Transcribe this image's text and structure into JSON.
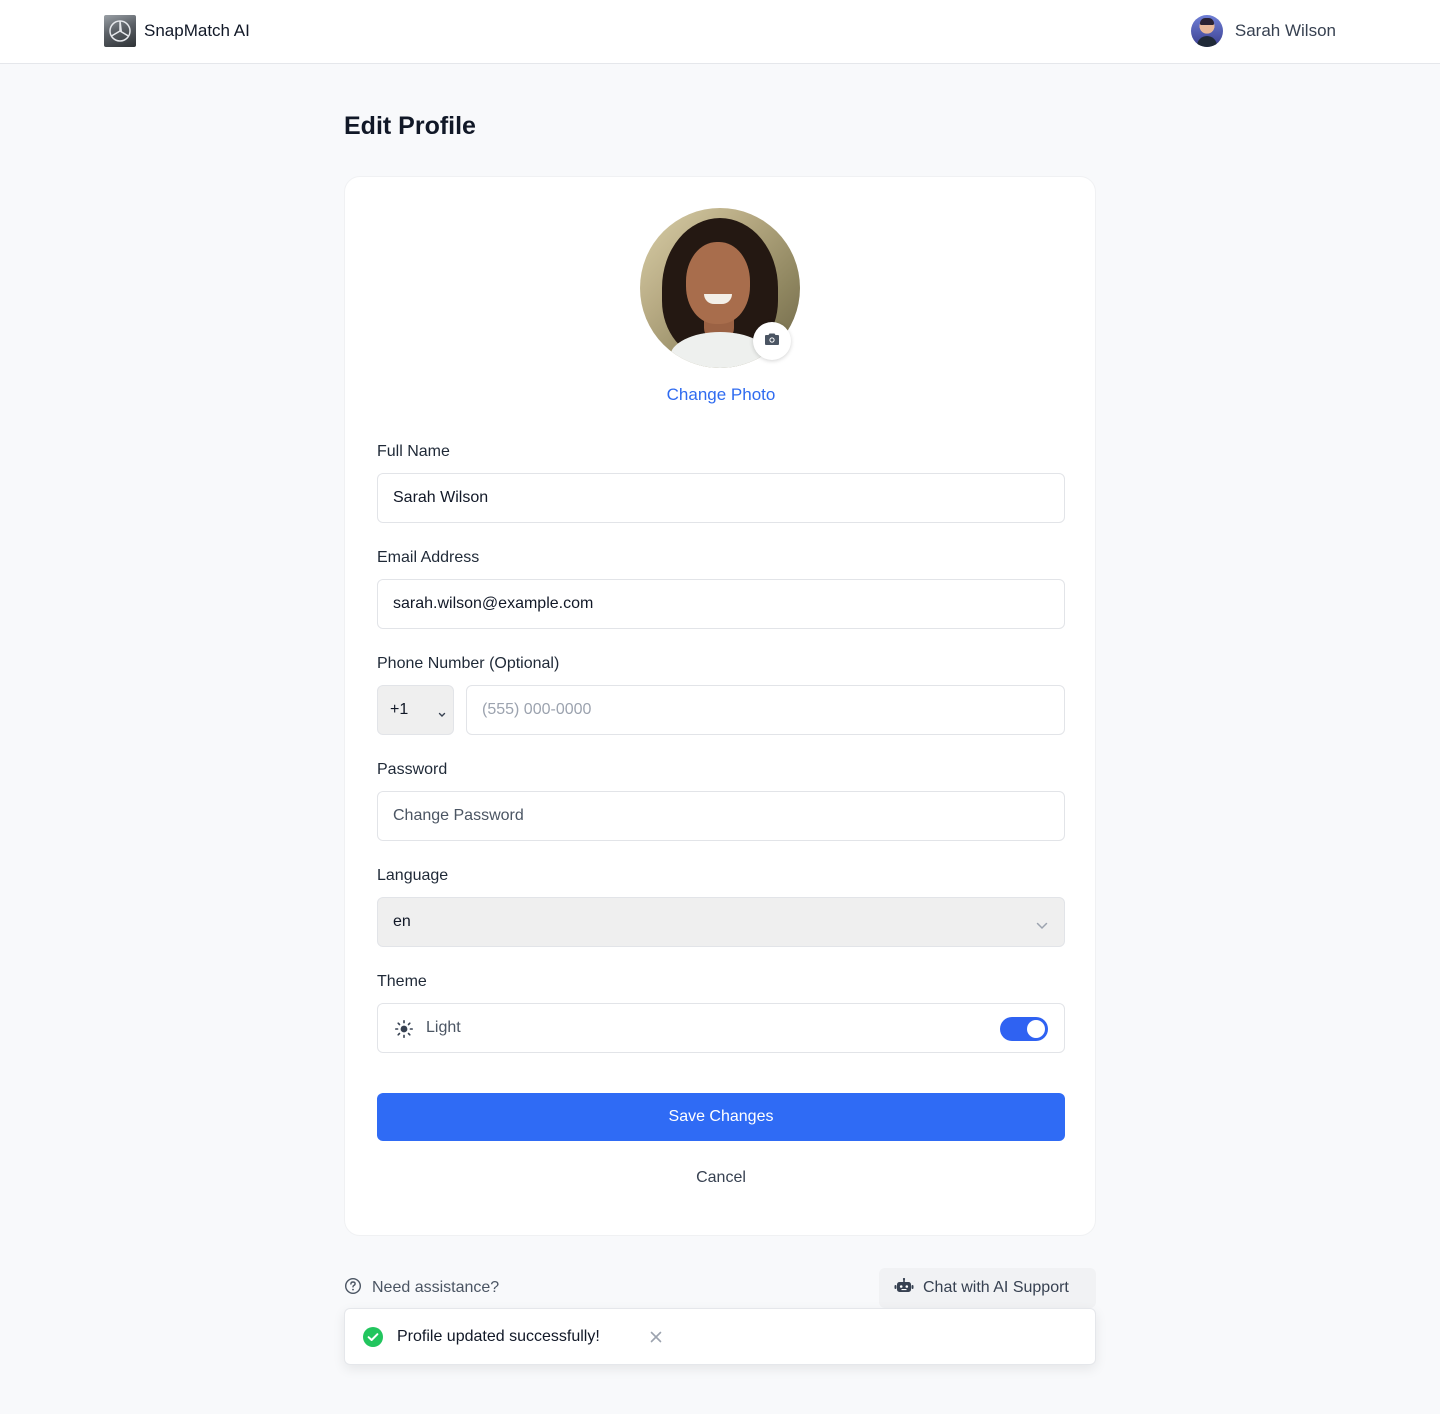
{
  "header": {
    "brand_name": "SnapMatch AI",
    "user_name": "Sarah Wilson"
  },
  "page": {
    "title": "Edit Profile"
  },
  "profile": {
    "change_photo_label": "Change Photo"
  },
  "form": {
    "full_name": {
      "label": "Full Name",
      "value": "Sarah Wilson"
    },
    "email": {
      "label": "Email Address",
      "value": "sarah.wilson@example.com"
    },
    "phone": {
      "label": "Phone Number (Optional)",
      "country_code": "+1",
      "placeholder": "(555) 000-0000"
    },
    "password": {
      "label": "Password",
      "placeholder": "Change Password"
    },
    "language": {
      "label": "Language",
      "value": "en"
    },
    "theme": {
      "label": "Theme",
      "value": "Light",
      "toggle_on": true
    }
  },
  "actions": {
    "save_label": "Save Changes",
    "cancel_label": "Cancel"
  },
  "help": {
    "text": "Need assistance?",
    "chat_label": "Chat with AI Support"
  },
  "toast": {
    "message": "Profile updated successfully!"
  },
  "colors": {
    "accent": "#2f6bf5",
    "success": "#22c55e",
    "link": "#2f6bf0"
  },
  "icons": [
    "camera-icon",
    "chevron-down-icon",
    "sun-icon",
    "help-circle-icon",
    "robot-icon",
    "check-circle-icon",
    "close-icon"
  ]
}
